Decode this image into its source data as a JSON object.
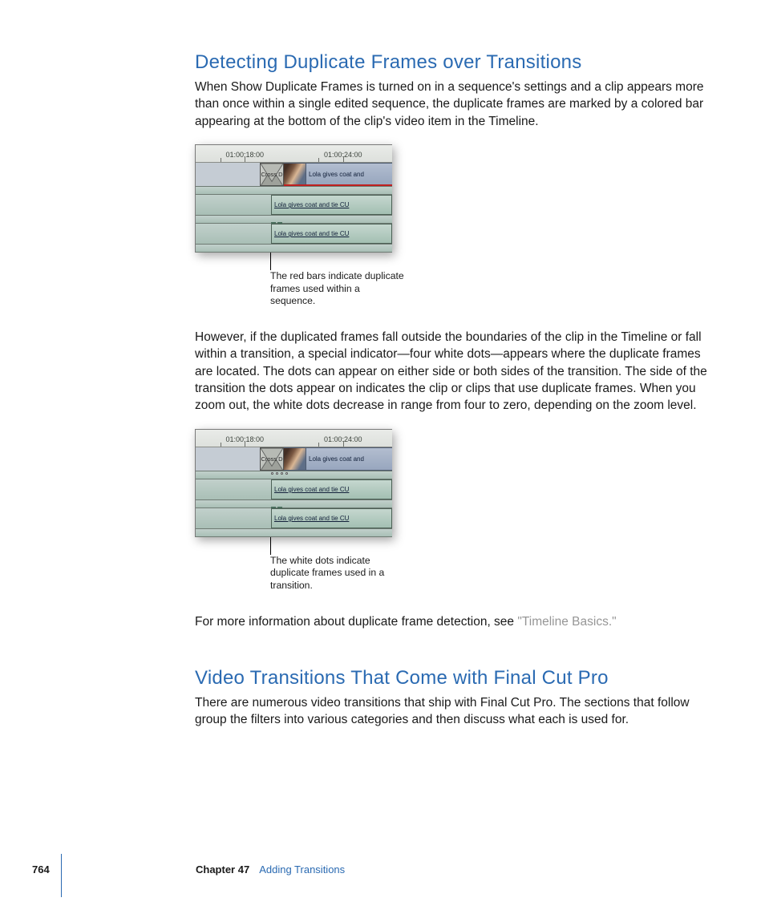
{
  "section1": {
    "heading": "Detecting Duplicate Frames over Transitions",
    "para1": "When Show Duplicate Frames is turned on in a sequence's settings and a clip appears more than once within a single edited sequence, the duplicate frames are marked by a colored bar appearing at the bottom of the clip's video item in the Timeline.",
    "para2": "However, if the duplicated frames fall outside the boundaries of the clip in the Timeline or fall within a transition, a special indicator—four white dots—appears where the duplicate frames are located. The dots can appear on either side or both sides of the transition. The side of the transition the dots appear on indicates the clip or clips that use duplicate frames. When you zoom out, the white dots decrease in range from four to zero, depending on the zoom level.",
    "para3_pre": "For more information about duplicate frame detection, see ",
    "para3_link": "\"Timeline Basics.\""
  },
  "fig1": {
    "ruler_a": "01:00:18:00",
    "ruler_b": "01:00:24:00",
    "transition_label": "Cross D",
    "video_clip_label": "Lola gives coat and",
    "audio_clip_label": "Lola gives coat and tie CU",
    "caption": "The red bars indicate duplicate frames used within a sequence."
  },
  "fig2": {
    "ruler_a": "01:00:18:00",
    "ruler_b": "01:00:24:00",
    "transition_label": "Cross D",
    "video_clip_label": "Lola gives coat and",
    "audio_clip_label": "Lola gives coat and tie CU",
    "caption": "The white dots indicate duplicate frames used in a transition."
  },
  "section2": {
    "heading": "Video Transitions That Come with Final Cut Pro",
    "para1": "There are numerous video transitions that ship with Final Cut Pro. The sections that follow group the filters into various categories and then discuss what each is used for."
  },
  "footer": {
    "page": "764",
    "chapter_label": "Chapter 47",
    "chapter_title": "Adding Transitions"
  }
}
